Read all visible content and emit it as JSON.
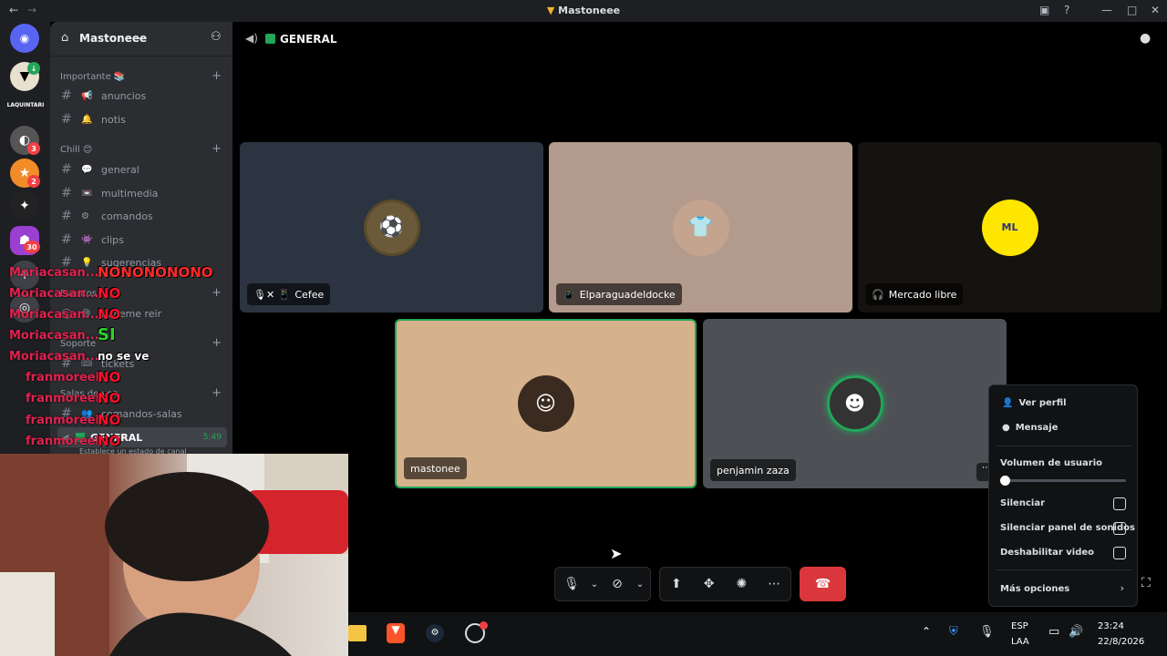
{
  "titlebar": {
    "title": "Mastoneee"
  },
  "rail": {
    "home_label": "Discord",
    "servers": [
      {
        "name": "server-1",
        "badge": ""
      },
      {
        "name": "LAQUINTARI",
        "badge": ""
      },
      {
        "name": "server-3",
        "badge": "3"
      },
      {
        "name": "server-4",
        "badge": "2"
      },
      {
        "name": "server-5",
        "badge": ""
      },
      {
        "name": "server-6",
        "badge": "30"
      }
    ],
    "label_laquintari": "LAQUINTARI"
  },
  "sidebar": {
    "server_name": "Mastoneee",
    "categories": {
      "importante": "Importante 📚",
      "chill": "Chill 😊",
      "eventos": "Eventos",
      "soporte": "Soporte",
      "salas": "Salas de voz"
    },
    "channels": [
      {
        "emoji": "📢",
        "name": "anuncios"
      },
      {
        "emoji": "🔔",
        "name": "notis"
      },
      {
        "emoji": "💬",
        "name": "general"
      },
      {
        "emoji": "📼",
        "name": "multimedia"
      },
      {
        "emoji": "⚙",
        "name": "comandos"
      },
      {
        "emoji": "👾",
        "name": "clips"
      },
      {
        "emoji": "💡",
        "name": "sugerencias"
      },
      {
        "emoji": "😄",
        "name": "haceme reir"
      },
      {
        "emoji": "🎟",
        "name": "tickets"
      },
      {
        "emoji": "👥",
        "name": "comandos-salas"
      }
    ],
    "voice_channel": {
      "name": "GENERAL",
      "time": "5:49",
      "status": "Establece un estado de canal"
    }
  },
  "overlay_chat": [
    {
      "user": "Moriacasan...",
      "msg": "NONONONONO",
      "kind": "no"
    },
    {
      "user": "Moriacasan...",
      "msg": "NO",
      "kind": "no"
    },
    {
      "user": "Moriacasan...",
      "msg": "NO",
      "kind": "no"
    },
    {
      "user": "Moriacasan...",
      "msg": "SI",
      "kind": "si"
    },
    {
      "user": "Moriacasan...",
      "msg": "no se ve",
      "kind": "plain"
    },
    {
      "user": "franmoreel",
      "msg": "NO",
      "kind": "no"
    },
    {
      "user": "franmoreel",
      "msg": "NO",
      "kind": "no"
    },
    {
      "user": "franmoreel",
      "msg": "NO",
      "kind": "no"
    },
    {
      "user": "franmoreel",
      "msg": "NO",
      "kind": "no"
    }
  ],
  "voice": {
    "channel_title": "GENERAL",
    "participants": [
      {
        "name": "Cefee",
        "icons": "🎙✕ 📱",
        "bg": "#2b3440"
      },
      {
        "name": "Elparaguadeldocke",
        "icons": "📱",
        "bg": "#b29a8c"
      },
      {
        "name": "Mercado libre",
        "icons": "🎧",
        "bg": "#15130f"
      },
      {
        "name": "mastonee",
        "icons": "",
        "bg": "#d6b28c"
      },
      {
        "name": "penjamin zaza",
        "icons": "",
        "bg": "#4f5055"
      }
    ]
  },
  "context_menu": {
    "ver_perfil": "Ver perfil",
    "mensaje": "Mensaje",
    "volumen": "Volumen de usuario",
    "volumen_level": 0.0,
    "silenciar": "Silenciar",
    "silenciar_sonidos": "Silenciar panel de sonidos",
    "deshabilitar_video": "Deshabilitar video",
    "mas_opciones": "Más opciones"
  },
  "taskbar": {
    "lang": "ESP",
    "layout": "LAA",
    "time": "23:24",
    "date": "22/8/2026"
  },
  "colors": {
    "accent_green": "#23a55a",
    "hangup_red": "#da373c",
    "overlay_user": "#e0224e"
  }
}
